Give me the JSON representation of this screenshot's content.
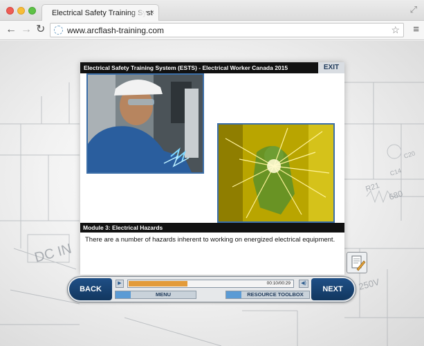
{
  "browser": {
    "tab_title": "Electrical Safety Training Syst",
    "tab_close": "×",
    "url": "www.arcflash-training.com",
    "icons": [
      "back-arrow-icon",
      "forward-arrow-icon",
      "reload-icon",
      "site-icon",
      "star-icon",
      "menu-icon",
      "expand-icon"
    ]
  },
  "course": {
    "title": "Electrical Safety Training System (ESTS) - Electrical Worker Canada 2015",
    "exit_label": "EXIT",
    "module_title": "Module 3: Electrical Hazards",
    "caption": "There are a number of hazards inherent to working on energized electrical equipment."
  },
  "controls": {
    "back_label": "BACK",
    "next_label": "NEXT",
    "time": "00:10/00:29",
    "progress_fraction": 0.36,
    "menu_label": "MENU",
    "toolbox_label": "RESOURCE TOOLBOX"
  },
  "blueprint_labels": {
    "r21": "R21",
    "r680": "680",
    "c14": "C14",
    "c20": "C20",
    "dc_in": "DC IN",
    "v250": "250V"
  },
  "colors": {
    "accent_blue": "#1f4f86",
    "progress_orange": "#e39b3a",
    "header_black": "#111111"
  }
}
